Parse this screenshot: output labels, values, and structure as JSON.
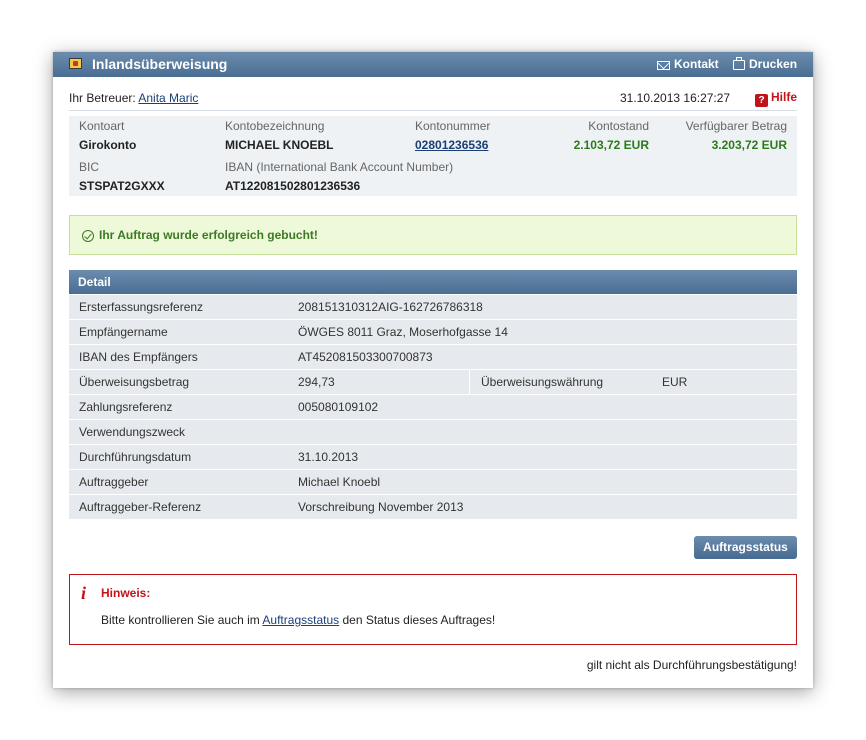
{
  "header": {
    "title": "Inlandsüberweisung",
    "contact_label": "Kontakt",
    "print_label": "Drucken"
  },
  "info": {
    "betreuer_prefix": "Ihr Betreuer:",
    "betreuer_name": "Anita Maric",
    "datetime": "31.10.2013 16:27:27",
    "help_label": "Hilfe"
  },
  "account": {
    "kontoart_label": "Kontoart",
    "kontoart_value": "Girokonto",
    "bezeichnung_label": "Kontobezeichnung",
    "bezeichnung_value": "MICHAEL KNOEBL",
    "nummer_label": "Kontonummer",
    "nummer_value": "02801236536",
    "stand_label": "Kontostand",
    "stand_value": "2.103,72 EUR",
    "verfuegbar_label": "Verfügbarer Betrag",
    "verfuegbar_value": "3.203,72 EUR",
    "bic_label": "BIC",
    "bic_value": "STSPAT2GXXX",
    "iban_label": "IBAN (International Bank Account Number)",
    "iban_value": "AT122081502801236536"
  },
  "success_message": "Ihr Auftrag wurde erfolgreich gebucht!",
  "detail": {
    "heading": "Detail",
    "rows": [
      {
        "key": "Ersterfassungsreferenz",
        "value": "208151310312AIG-162726786318"
      },
      {
        "key": "Empfängername",
        "value": "ÖWGES 8011 Graz, Moserhofgasse 14"
      },
      {
        "key": "IBAN des Empfängers",
        "value": "AT452081503300700873"
      },
      {
        "key": "Überweisungsbetrag",
        "value": "294,73",
        "key2": "Überweisungswährung",
        "value2": "EUR"
      },
      {
        "key": "Zahlungsreferenz",
        "value": "005080109102"
      },
      {
        "key": "Verwendungszweck",
        "value": ""
      },
      {
        "key": "Durchführungsdatum",
        "value": "31.10.2013"
      },
      {
        "key": "Auftraggeber",
        "value": "Michael Knoebl"
      },
      {
        "key": "Auftraggeber-Referenz",
        "value": "Vorschreibung November 2013"
      }
    ]
  },
  "status_button_label": "Auftragsstatus",
  "hinweis": {
    "icon_letter": "i",
    "title": "Hinweis:",
    "text_before": "Bitte kontrollieren Sie auch im ",
    "link_text": "Auftragsstatus",
    "text_after": " den Status dieses Auftrages!"
  },
  "footer_note": "gilt nicht als Durchführungsbestätigung!",
  "colors": {
    "header_blue": "#4a6d92",
    "success_green": "#3d7a25",
    "alert_red": "#c0141b"
  }
}
